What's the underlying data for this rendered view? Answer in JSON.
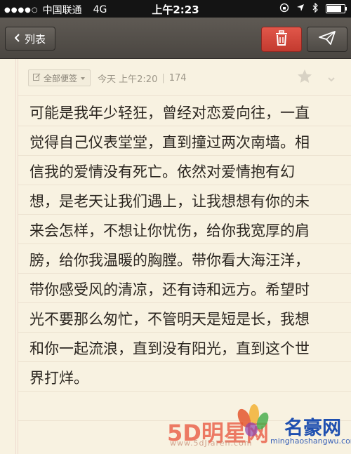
{
  "status_bar": {
    "signal": "●●●●○",
    "carrier": "中国联通",
    "network": "4G",
    "time": "上午2:23"
  },
  "toolbar": {
    "back_label": "列表",
    "delete_icon": "trash-icon",
    "send_icon": "paper-plane-icon",
    "delete_color": "#d64a3d"
  },
  "note": {
    "folder_label": "全部便签",
    "date": "今天 上午2:20",
    "char_count": "174",
    "lines": [
      "可能是我年少轻狂，曾经对恋爱向往，一直",
      "觉得自己仪表堂堂，直到撞过两次南墙。相",
      "信我的爱情没有死亡。依然对爱情抱有幻",
      "想，是老天让我们遇上，让我想想有你的未",
      "来会怎样，不想让你忧伤，给你我宽厚的肩",
      "膀，给你我温暖的胸膛。带你看大海汪洋，",
      "带你感受风的清凉，还有诗和远方。希望时",
      "光不要那么匆忙，不管明天是短是长，我想",
      "和你一起流浪，直到没有阳光，直到这个世",
      "界打烊。"
    ]
  },
  "watermark": {
    "left_logo": "5D明星网",
    "left_url": "www.5dJiaren.com",
    "right_logo": "名豪网",
    "right_url": "minghaoshangwu.com"
  }
}
